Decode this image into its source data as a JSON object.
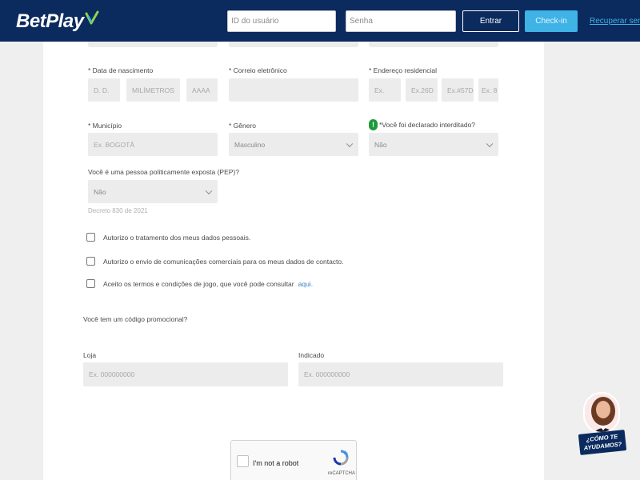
{
  "header": {
    "logo_text": "BetPlay",
    "user_placeholder": "ID do usuário",
    "password_placeholder": "Senha",
    "login_label": "Entrar",
    "checkin_label": "Check-in",
    "recover_label": "Recuperar senha",
    "colors": {
      "bar": "#0b2a5e",
      "accent": "#3fb2e6",
      "logo_mark": "#8fd14f"
    }
  },
  "form": {
    "birth": {
      "label": "* Data de nascimento",
      "day_placeholder": "D. D.",
      "month_placeholder": "MILÍMETROS",
      "year_placeholder": "AAAA"
    },
    "email": {
      "label": "* Correio eletrônico"
    },
    "address": {
      "label": "* Endereço residencial",
      "parts": [
        "Ex.",
        "Ex.26D",
        "Ex.#57D",
        "Ex. 8"
      ]
    },
    "municipality": {
      "label": "* Município",
      "placeholder": "Ex. BOGOTÁ"
    },
    "gender": {
      "label": "* Gênero",
      "value": "Masculino"
    },
    "interdicted": {
      "warning_symbol": "!",
      "label": "*Você foi declarado interditado?",
      "value": "Não"
    },
    "pep": {
      "label": "Você é uma pessoa politicamente exposta (PEP)?",
      "value": "Não",
      "note": "Decreto 830 de 2021"
    },
    "consents": [
      {
        "text": "Autorizo o tratamento dos meus dados pessoais."
      },
      {
        "text": "Autorizo o envio de comunicações comerciais para os meus dados de contacto."
      },
      {
        "text": "Aceito os termos e condições de jogo, que você pode consultar",
        "link": "aqui."
      }
    ],
    "promo": {
      "question": "Você tem um código promocional?",
      "store_label": "Loja",
      "store_placeholder": "Ex. 000000000",
      "referred_label": "Indicado",
      "referred_placeholder": "Ex. 000000000"
    }
  },
  "recaptcha": {
    "text": "I'm not a robot",
    "brand": "reCAPTCHA"
  },
  "help": {
    "line1": "¿CÓMO TE",
    "line2": "AYUDAMOS?"
  }
}
